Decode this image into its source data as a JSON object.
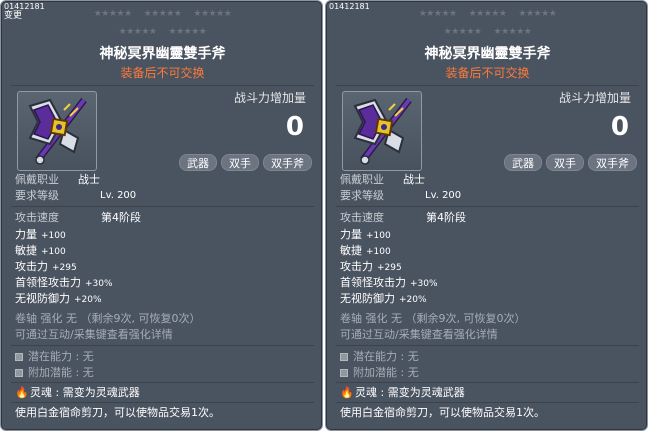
{
  "item": {
    "id": "01412181",
    "change_label": "变更",
    "stars_row1": [
      "★★★★★",
      "★★★★★",
      "★★★★★"
    ],
    "stars_row2": [
      "★★★★★",
      "★★★★★"
    ],
    "name": "神秘冥界幽靈雙手斧",
    "trade_note": "装备后不可交换",
    "combat_power_label": "战斗力增加量",
    "combat_power_value": "0",
    "tags": [
      "武器",
      "双手",
      "双手斧"
    ],
    "job_label": "佩戴职业",
    "job_value": "战士",
    "level_label": "要求等级",
    "level_value": "Lv. 200",
    "attack_speed_label": "攻击速度",
    "attack_speed_value": "第4阶段",
    "stats": [
      {
        "label": "力量",
        "value": "+100"
      },
      {
        "label": "敏捷",
        "value": "+100"
      },
      {
        "label": "攻击力",
        "value": "+295"
      },
      {
        "label": "首领怪攻击力",
        "value": "+30%"
      },
      {
        "label": "无视防御力",
        "value": "+20%"
      }
    ],
    "scroll_line": "卷轴 强化 无 （剩余9次, 可恢复0次）",
    "enhance_line": "可通过互动/采集键查看强化详情",
    "potential": {
      "label": "潜在能力",
      "value": "无"
    },
    "bonus_potential": {
      "label": "附加潜能",
      "value": "无"
    },
    "soul": {
      "label": "灵魂",
      "value": "需变为灵魂武器"
    },
    "footer_note": "使用白金宿命剪刀，可以使物品交易1次。"
  },
  "colors": {
    "panel_bg": "#4a5360",
    "trade_note": "#ff7a3a",
    "tag_bg": "#6b7480"
  }
}
